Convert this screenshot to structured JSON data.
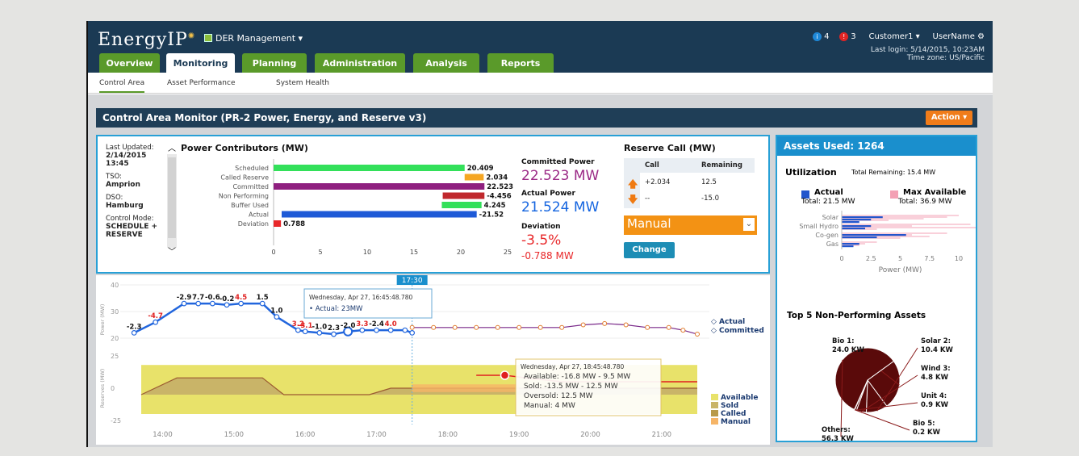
{
  "app": {
    "logo": "EnergyIP",
    "logo_mark": "✺",
    "module": "DER Management ▾"
  },
  "tabs": [
    {
      "label": "Overview"
    },
    {
      "label": "Monitoring"
    },
    {
      "label": "Planning"
    },
    {
      "label": "Administration"
    },
    {
      "label": "Analysis"
    },
    {
      "label": "Reports"
    }
  ],
  "header": {
    "info_count": "4",
    "alert_count": "3",
    "customer": "Customer1 ▾",
    "username": "UserName",
    "last_login": "Last login: 5/14/2015, 10:23AM",
    "timezone": "Time zone: US/Pacific"
  },
  "subnav": [
    "Control Area",
    "Asset Performance",
    "System Health"
  ],
  "page": {
    "title": "Control Area Monitor (PR-2 Power, Energy, and Reserve v3)",
    "action": "Action ▾"
  },
  "info": {
    "last_updated_label": "Last Updated:",
    "last_updated": "2/14/2015 13:45",
    "tso_label": "TSO:",
    "tso": "Amprion",
    "dso_label": "DSO:",
    "dso": "Hamburg",
    "mode_label": "Control Mode:",
    "mode": "SCHEDULE + RESERVE"
  },
  "power": {
    "title": "Power Contributors (MW)",
    "committed_label": "Committed Power",
    "committed_value": "22.523 MW",
    "actual_label": "Actual Power",
    "actual_value": "21.524 MW",
    "deviation_label": "Deviation",
    "deviation_pct": "-3.5%",
    "deviation_mw": "-0.788 MW",
    "colors": {
      "committed": "#9b2a86",
      "actual": "#1565e0",
      "deviation": "#e8282a"
    }
  },
  "reserve": {
    "title": "Reserve Call (MW)",
    "col_call": "Call",
    "col_remaining": "Remaining",
    "rows": [
      {
        "call": "+2.034",
        "remaining": "12.5",
        "dir": "up"
      },
      {
        "call": "--",
        "remaining": "-15.0",
        "dir": "down"
      }
    ],
    "mode_value": "Manual",
    "change": "Change"
  },
  "assets": {
    "title": "Assets Used: 1264",
    "utilization": "Utilization",
    "total_remaining": "Total Remaining: 15.4 MW",
    "actual_label": "Actual",
    "actual_total": "Total: 21.5 MW",
    "max_label": "Max Available",
    "max_total": "Total: 36.9 MW",
    "top5_title": "Top 5 Non-Performing Assets",
    "pie_labels": [
      {
        "name": "Bio 1:",
        "value": "24.0 KW"
      },
      {
        "name": "Solar 2:",
        "value": "10.4 KW"
      },
      {
        "name": "Wind 3:",
        "value": "4.8 KW"
      },
      {
        "name": "Unit 4:",
        "value": "0.9 KW"
      },
      {
        "name": "Bio 5:",
        "value": "0.2 KW"
      },
      {
        "name": "Others:",
        "value": "56.3 KW"
      }
    ]
  },
  "timeline": {
    "cursor_label": "17:30",
    "tooltip1": {
      "date": "Wednesday, Apr 27, 16:45:48.780",
      "actual": "• Actual: 23MW"
    },
    "tooltip2": {
      "date": "Wednesday, Apr 27, 18:45:48.780",
      "available": "Available: -16.8 MW - 9.5 MW",
      "sold": "Sold: -13.5 MW - 12.5 MW",
      "oversold": "Oversold: 12.5 MW",
      "manual": "Manual: 4 MW"
    }
  },
  "chart_data": [
    {
      "type": "bar",
      "title": "Power Contributors (MW)",
      "categories": [
        "Scheduled",
        "Called Reserve",
        "Committed",
        "Non Performing",
        "Buffer Used",
        "Actual",
        "Deviation"
      ],
      "values": [
        20.409,
        2.034,
        22.523,
        -4.456,
        4.245,
        -21.524,
        0.788
      ],
      "value_labels": [
        "20.409",
        "2.034",
        "22.523",
        "-4.456",
        "4.245",
        "-21.52",
        "0.788"
      ],
      "colors": [
        "#33e05a",
        "#f5a623",
        "#8f1f7f",
        "#c0282c",
        "#33e05a",
        "#1e5ad7",
        "#e8282a"
      ],
      "xlim": [
        0,
        25
      ],
      "xticks": [
        0,
        5,
        10,
        15,
        20,
        25
      ]
    },
    {
      "type": "line",
      "ylabel": "Power (MW)",
      "ylim": [
        20,
        40
      ],
      "yticks": [
        20,
        30,
        40
      ],
      "xticks": [
        "14:00",
        "15:00",
        "16:00",
        "17:00",
        "18:00",
        "19:00",
        "20:00",
        "21:00"
      ],
      "series": [
        {
          "name": "Actual",
          "color": "#2266dd",
          "x": [
            13.6,
            13.9,
            14.3,
            14.5,
            14.7,
            14.9,
            15.1,
            15.4,
            15.6,
            15.9,
            16.0,
            16.2,
            16.4,
            16.6,
            16.8,
            17.0,
            17.2,
            17.4,
            17.5
          ],
          "y": [
            22,
            26,
            33,
            33,
            33,
            32.5,
            33,
            33,
            28,
            23,
            22.5,
            22,
            21.5,
            22.5,
            23,
            23,
            23,
            23,
            22
          ],
          "labels": [
            "-2.3",
            "-4.7",
            "-2.9",
            "7.7",
            "-0.6",
            "-0.2",
            "4.5",
            "1.5",
            "1.0",
            "3.2",
            "-3.1",
            "-1.0",
            "2.3",
            "-2.0",
            "3.3",
            "-2.4",
            "4.0",
            "",
            ""
          ]
        },
        {
          "name": "Committed",
          "color": "#e07a2a",
          "x": [
            17.5,
            17.8,
            18.1,
            18.4,
            18.7,
            19.0,
            19.3,
            19.6,
            19.9,
            20.2,
            20.5,
            20.8,
            21.1,
            21.3,
            21.5
          ],
          "y": [
            24,
            24,
            24,
            24,
            24,
            24,
            24,
            24,
            25,
            25.5,
            25,
            24,
            24,
            23,
            21.5
          ]
        }
      ]
    },
    {
      "type": "area",
      "ylabel": "Reserves (MW)",
      "ylim": [
        -25,
        25
      ],
      "yticks": [
        -25,
        0,
        25
      ],
      "xticks": [
        "14:00",
        "15:00",
        "16:00",
        "17:00",
        "18:00",
        "19:00",
        "20:00",
        "21:00"
      ],
      "series": [
        {
          "name": "Available"
        },
        {
          "name": "Sold"
        },
        {
          "name": "Called"
        },
        {
          "name": "Manual"
        }
      ]
    },
    {
      "type": "bar",
      "title": "Utilization",
      "xlabel": "Power (MW)",
      "xlim": [
        0,
        12.5
      ],
      "xticks": [
        "0",
        "2.5",
        "5",
        "7.5",
        "10",
        "1..."
      ],
      "categories": [
        "Solar",
        "Small Hydro",
        "Co-gen",
        "Gas"
      ],
      "series": [
        {
          "name": "Actual",
          "color": "#2255cc"
        },
        {
          "name": "Max Available",
          "color": "#f3a0b4"
        }
      ]
    },
    {
      "type": "pie",
      "title": "Top 5 Non-Performing Assets",
      "categories": [
        "Bio 1",
        "Solar 2",
        "Wind 3",
        "Unit 4",
        "Bio 5",
        "Others"
      ],
      "values": [
        24.0,
        10.4,
        4.8,
        0.9,
        0.2,
        56.3
      ],
      "color": "#5a0a0a"
    }
  ]
}
